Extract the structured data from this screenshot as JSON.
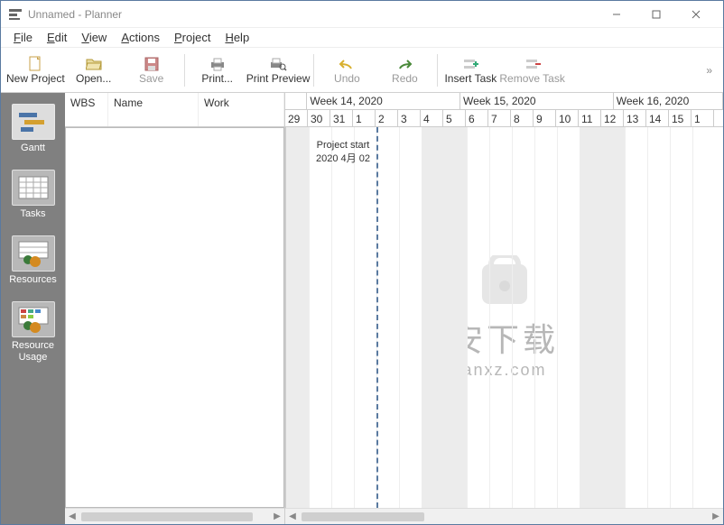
{
  "window": {
    "title": "Unnamed - Planner"
  },
  "menu": {
    "file": "File",
    "edit": "Edit",
    "view": "View",
    "actions": "Actions",
    "project": "Project",
    "help": "Help"
  },
  "toolbar": {
    "new_project": "New Project",
    "open": "Open...",
    "save": "Save",
    "print": "Print...",
    "print_preview": "Print Preview",
    "undo": "Undo",
    "redo": "Redo",
    "insert_task": "Insert Task",
    "remove_task": "Remove Task"
  },
  "sidebar": {
    "gantt": "Gantt",
    "tasks": "Tasks",
    "resources": "Resources",
    "resource_usage": "Resource\nUsage"
  },
  "table": {
    "columns": {
      "wbs": "WBS",
      "name": "Name",
      "work": "Work"
    }
  },
  "gantt": {
    "weeks": [
      {
        "label": "",
        "days": 1
      },
      {
        "label": "Week 14, 2020",
        "days": 7
      },
      {
        "label": "Week 15, 2020",
        "days": 7
      },
      {
        "label": "Week 16, 2020",
        "days": 5
      }
    ],
    "days": [
      "29",
      "30",
      "31",
      "1",
      "2",
      "3",
      "4",
      "5",
      "6",
      "7",
      "8",
      "9",
      "10",
      "11",
      "12",
      "13",
      "14",
      "15",
      "1"
    ],
    "weekend_indices": [
      0,
      6,
      7,
      13,
      14
    ],
    "start_index": 4,
    "marker": {
      "line1": "Project start",
      "line2": "2020 4月 02"
    }
  },
  "watermark": {
    "big": "安下载",
    "small": "anxz.com"
  }
}
